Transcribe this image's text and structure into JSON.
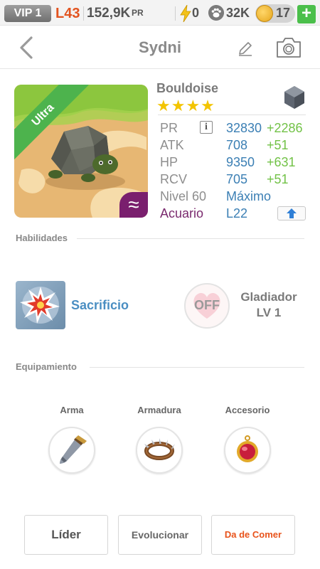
{
  "status_bar": {
    "vip": "VIP 1",
    "level": "L43",
    "power": "152,9K",
    "power_unit": "PR",
    "energy": "0",
    "paws": "32K",
    "coins": "17",
    "add_label": "+"
  },
  "header": {
    "title": "Sydni"
  },
  "creature": {
    "name": "Bouldoise",
    "rarity": "Ultra",
    "stars": "★★★★",
    "element_symbol": "≈",
    "stats": [
      {
        "label": "PR",
        "value": "32830",
        "bonus": "+2286"
      },
      {
        "label": "ATK",
        "value": "708",
        "bonus": "+51"
      },
      {
        "label": "HP",
        "value": "9350",
        "bonus": "+631"
      },
      {
        "label": "RCV",
        "value": "705",
        "bonus": "+51"
      }
    ],
    "level_label": "Nivel 60",
    "level_value": "Máximo",
    "sign_label": "Acuario",
    "sign_value": "L22",
    "info_glyph": "i"
  },
  "abilities": {
    "title": "Habilidades",
    "active_name": "Sacrificio",
    "passive_state": "OFF",
    "passive_name": "Gladiador",
    "passive_level": "LV 1"
  },
  "equipment": {
    "title": "Equipamiento",
    "slots": [
      {
        "label": "Arma"
      },
      {
        "label": "Armadura"
      },
      {
        "label": "Accesorio"
      }
    ]
  },
  "buttons": {
    "leader": "Líder",
    "evolve": "Evolucionar",
    "feed": "Da de Comer"
  },
  "colors": {
    "accent_blue": "#3b7fb4",
    "bonus_green": "#72c247",
    "level_orange": "#e2531f",
    "feed_orange": "#e8531b",
    "sign_purple": "#7a2a6e",
    "star_yellow": "#f3c400",
    "rarity_green": "#4db34d"
  }
}
